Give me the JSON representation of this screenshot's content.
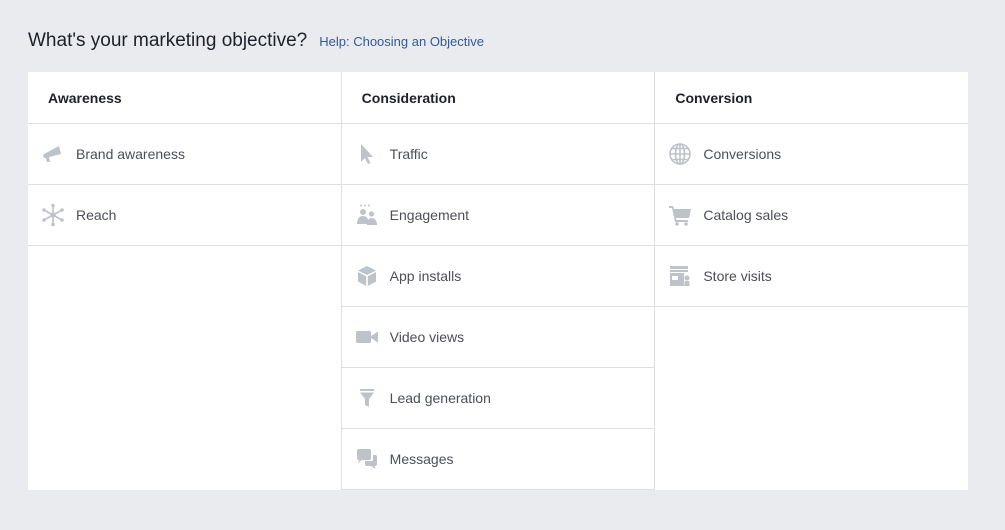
{
  "header": {
    "title": "What's your marketing objective?",
    "help_link": "Help: Choosing an Objective"
  },
  "colors": {
    "icon": "#bec3c9",
    "link": "#365899",
    "divider": "#dddfe2",
    "background": "#e9ebee"
  },
  "columns": [
    {
      "title": "Awareness",
      "items": [
        {
          "label": "Brand awareness",
          "icon": "megaphone-icon"
        },
        {
          "label": "Reach",
          "icon": "reach-burst-icon"
        }
      ]
    },
    {
      "title": "Consideration",
      "items": [
        {
          "label": "Traffic",
          "icon": "cursor-arrow-icon"
        },
        {
          "label": "Engagement",
          "icon": "people-engagement-icon"
        },
        {
          "label": "App installs",
          "icon": "box-icon"
        },
        {
          "label": "Video views",
          "icon": "video-camera-icon"
        },
        {
          "label": "Lead generation",
          "icon": "funnel-icon"
        },
        {
          "label": "Messages",
          "icon": "chat-bubbles-icon"
        }
      ]
    },
    {
      "title": "Conversion",
      "items": [
        {
          "label": "Conversions",
          "icon": "globe-icon"
        },
        {
          "label": "Catalog sales",
          "icon": "shopping-cart-icon"
        },
        {
          "label": "Store visits",
          "icon": "storefront-icon"
        }
      ]
    }
  ]
}
